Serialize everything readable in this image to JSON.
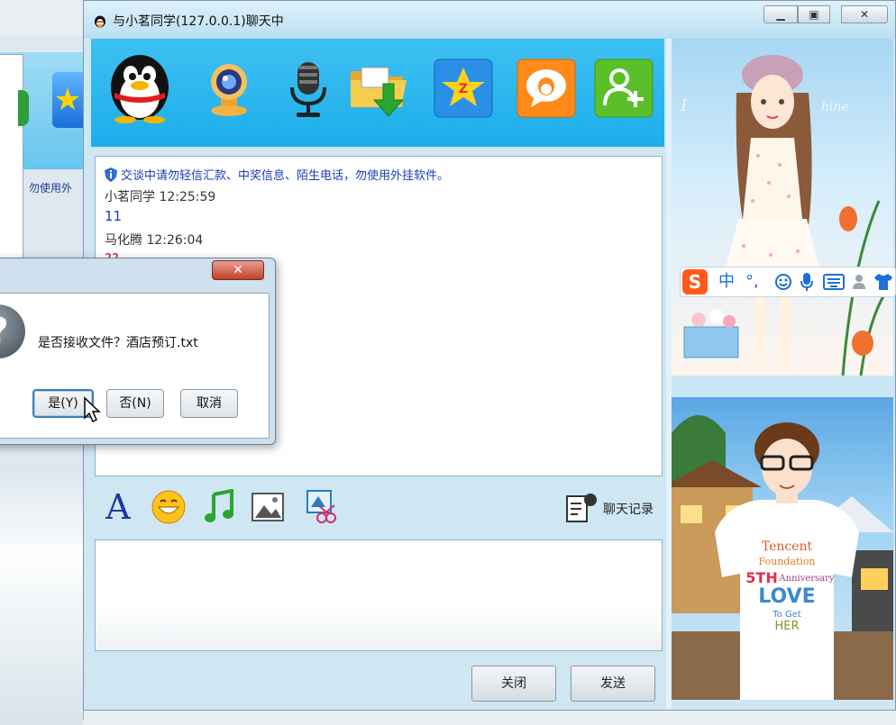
{
  "window": {
    "title": "与小茗同学(127.0.0.1)聊天中",
    "min_glyph": "▁",
    "max_glyph": "▣",
    "close_glyph": "✕"
  },
  "toolbar": {
    "icons": [
      "qq-penguin-icon",
      "webcam-icon",
      "microphone-icon",
      "file-transfer-icon",
      "qzone-star-icon",
      "qq-bubble-icon",
      "add-friend-icon"
    ]
  },
  "background_window": {
    "note": "勿使用外"
  },
  "messages": {
    "security_note": "交谈中请勿轻信汇款、中奖信息、陌生电话，勿使用外挂软件。",
    "items": [
      {
        "sender_time": "小茗同学 12:25:59",
        "text": "11"
      },
      {
        "sender_time": "马化腾 12:26:04",
        "text": "??"
      }
    ]
  },
  "format_bar": {
    "font_glyph": "A",
    "history_label": "聊天记录"
  },
  "buttons": {
    "close": "关闭",
    "send": "发送"
  },
  "ime": {
    "logo": "S",
    "mode": "中",
    "punct": "°,"
  },
  "dialog": {
    "close_glyph": "✕",
    "icon_glyph": "?",
    "message": "是否接收文件？酒店预订.txt",
    "yes": "是(Y)",
    "no": "否(N)",
    "cancel": "取消"
  },
  "colors": {
    "toolbar_blue": "#1caeea",
    "notice_blue": "#1a3dbb",
    "ime_orange": "#ff5a1a"
  }
}
